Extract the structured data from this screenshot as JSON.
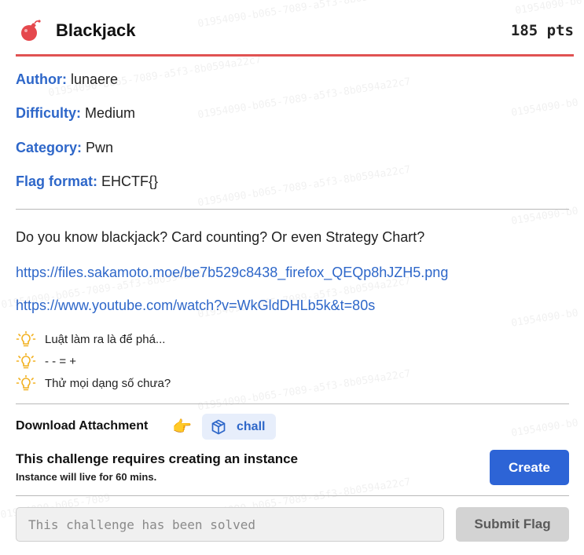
{
  "challenge": {
    "title": "Blackjack",
    "points": "185 pts",
    "icon": "bomb-icon"
  },
  "meta": {
    "author_label": "Author:",
    "author": "lunaere",
    "difficulty_label": "Difficulty:",
    "difficulty": "Medium",
    "category_label": "Category:",
    "category": "Pwn",
    "flag_format_label": "Flag format:",
    "flag_format": "EHCTF{}"
  },
  "description": {
    "text": "Do you know blackjack? Card counting? Or even Strategy Chart?",
    "links": [
      "https://files.sakamoto.moe/be7b529c8438_firefox_QEQp8hJZH5.png",
      "https://www.youtube.com/watch?v=WkGldDHLb5k&t=80s"
    ]
  },
  "hints": [
    "Luật làm ra là để phá...",
    "- - = +",
    "Thử mọi dạng số chưa?"
  ],
  "attachment": {
    "label": "Download Attachment",
    "pointer": "👉",
    "file": "chall"
  },
  "instance": {
    "title": "This challenge requires creating an instance",
    "subtitle": "Instance will live for 60 mins.",
    "create_label": "Create"
  },
  "flag": {
    "placeholder": "This challenge has been solved",
    "submit_label": "Submit Flag"
  },
  "colors": {
    "accent": "#2e67c9",
    "header_rule": "#e05252",
    "bomb": "#e5484d",
    "hint_icon": "#f2b01e"
  }
}
